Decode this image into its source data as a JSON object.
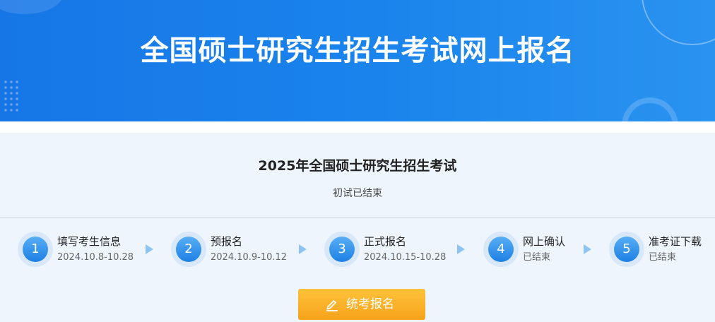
{
  "banner": {
    "title": "全国硕士研究生招生考试网上报名"
  },
  "exam": {
    "title": "2025年全国硕士研究生招生考试",
    "status": "初试已结束"
  },
  "steps": [
    {
      "num": "1",
      "name": "填写考生信息",
      "date": "2024.10.8-10.28"
    },
    {
      "num": "2",
      "name": "预报名",
      "date": "2024.10.9-10.12"
    },
    {
      "num": "3",
      "name": "正式报名",
      "date": "2024.10.15-10.28"
    },
    {
      "num": "4",
      "name": "网上确认",
      "date": "已结束"
    },
    {
      "num": "5",
      "name": "准考证下载",
      "date": "已结束"
    }
  ],
  "cta": {
    "label": "统考报名",
    "icon": "pencil-icon"
  },
  "colors": {
    "banner_blue": "#1a83ec",
    "step_blue": "#1d80e4",
    "cta_orange": "#f7a21b",
    "panel_bg": "#eef5fd"
  }
}
